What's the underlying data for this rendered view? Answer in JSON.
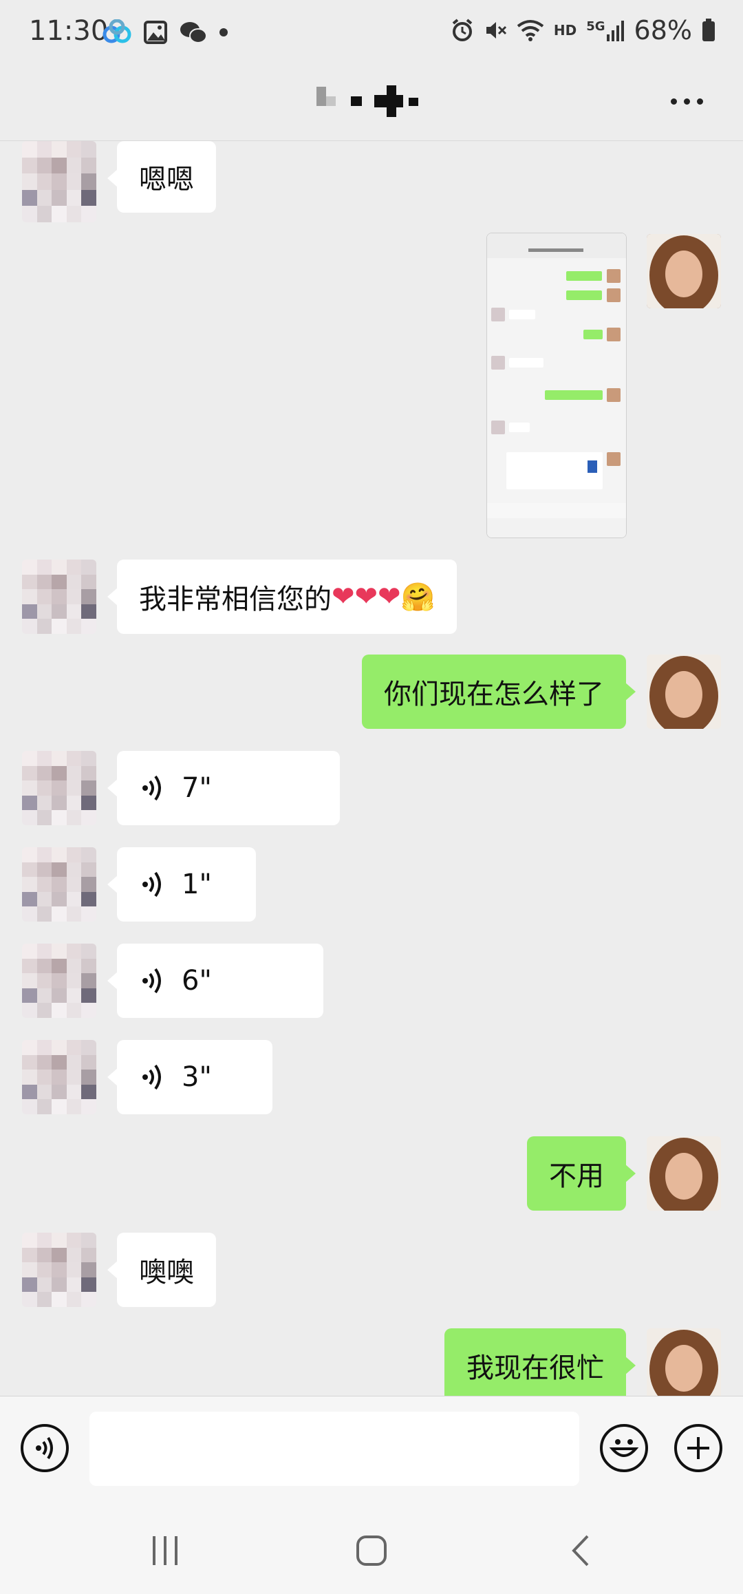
{
  "status_bar": {
    "time": "11:30",
    "hd": "HD",
    "network": "5G",
    "battery": "68%"
  },
  "header": {
    "more_label": "..."
  },
  "messages": [
    {
      "side": "in",
      "text": "嗯嗯"
    },
    {
      "side": "out",
      "type": "image",
      "text": ""
    },
    {
      "side": "in",
      "text_main": "我非常相信您的",
      "hearts": "❤❤❤",
      "emoji": "🤗"
    },
    {
      "side": "out",
      "text": "你们现在怎么样了"
    },
    {
      "side": "in",
      "type": "voice",
      "duration": "7\""
    },
    {
      "side": "in",
      "type": "voice",
      "duration": "1\""
    },
    {
      "side": "in",
      "type": "voice",
      "duration": "6\""
    },
    {
      "side": "in",
      "type": "voice",
      "duration": "3\""
    },
    {
      "side": "out",
      "text": "不用"
    },
    {
      "side": "in",
      "text": "噢噢"
    },
    {
      "side": "out",
      "text": "我现在很忙"
    }
  ],
  "input_bar": {
    "value": "",
    "placeholder": ""
  },
  "icons": [
    "voice-toggle-icon",
    "emoji-icon",
    "plus-icon",
    "more-icon",
    "voice-wave-icon",
    "recent-apps-icon",
    "home-icon",
    "back-icon"
  ],
  "colors": {
    "outgoing_bubble": "#95ec69",
    "incoming_bubble": "#ffffff",
    "background": "#ededed"
  }
}
